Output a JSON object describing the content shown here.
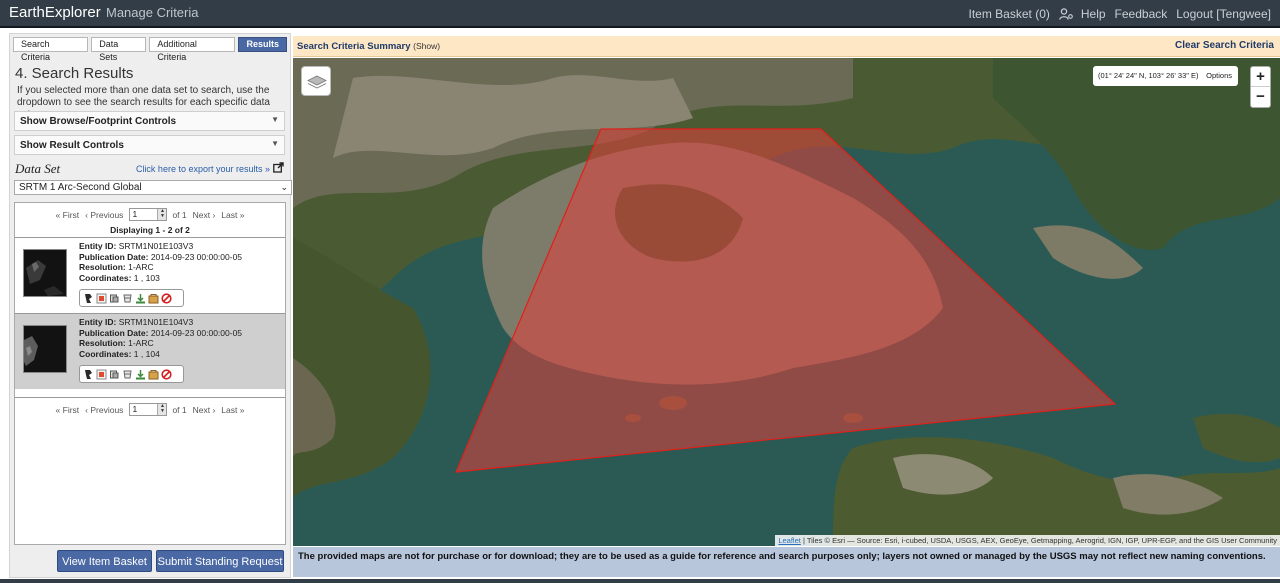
{
  "navbar": {
    "brand": "EarthExplorer",
    "manage": "Manage Criteria",
    "basket": "Item Basket (0)",
    "help": "Help",
    "feedback": "Feedback",
    "logout": "Logout [Tengwee]"
  },
  "tabs": [
    {
      "label": "Search Criteria"
    },
    {
      "label": "Data Sets"
    },
    {
      "label": "Additional Criteria"
    },
    {
      "label": "Results"
    }
  ],
  "results_panel": {
    "title": "4. Search Results",
    "description": "If you selected more than one data set to search, use the dropdown to see the search results for each specific data set.",
    "browse_controls": "Show Browse/Footprint Controls",
    "result_controls": "Show Result Controls",
    "dataset_label": "Data Set",
    "export_link": "Click here to export your results »",
    "dataset_selected": "SRTM 1 Arc-Second Global",
    "pager": {
      "first": "« First",
      "previous": "‹ Previous",
      "page": "1",
      "of": "of 1",
      "next": "Next ›",
      "last": "Last »"
    },
    "displaying": "Displaying 1 - 2 of 2",
    "results": [
      {
        "entity_label": "Entity ID:",
        "entity_id": "SRTM1N01E103V3",
        "pub_label": "Publication Date:",
        "pub_date": "2014-09-23 00:00:00-05",
        "res_label": "Resolution:",
        "resolution": "1-ARC",
        "coord_label": "Coordinates:",
        "coordinates": "1 , 103"
      },
      {
        "entity_label": "Entity ID:",
        "entity_id": "SRTM1N01E104V3",
        "pub_label": "Publication Date:",
        "pub_date": "2014-09-23 00:00:00-05",
        "res_label": "Resolution:",
        "resolution": "1-ARC",
        "coord_label": "Coordinates:",
        "coordinates": "1 , 104"
      }
    ],
    "action_icons": [
      "footprint-icon",
      "browse-overlay-icon",
      "compare-icon",
      "metadata-icon",
      "download-icon",
      "order-icon",
      "exclude-icon"
    ],
    "basket_button": "View Item Basket »",
    "standing_button": "Submit Standing Request »"
  },
  "summary": {
    "title": "Search Criteria Summary",
    "show": "(Show)",
    "clear": "Clear Search Criteria"
  },
  "map": {
    "coordinates": "(01° 24' 24\" N, 103° 26' 33\" E)",
    "options": "Options",
    "zoom_in": "+",
    "zoom_out": "−",
    "attribution_link": "Leaflet",
    "attribution_text": " | Tiles © Esri — Source: Esri, i-cubed, USDA, USGS, AEX, GeoEye, Getmapping, Aerogrid, IGN, IGP, UPR-EGP, and the GIS User Community",
    "polygon_color": "#e3403a",
    "disclaimer": "The provided maps are not for purchase or for download; they are to be used as a guide for reference and search purposes only; layers not owned or managed by the USGS may not reflect new naming conventions."
  },
  "colors": {
    "navbar": "#333d47",
    "tab_active": "#4a68a3",
    "summary_bar": "#fde7c4",
    "disclaimer_bar": "#b8c6dc"
  }
}
